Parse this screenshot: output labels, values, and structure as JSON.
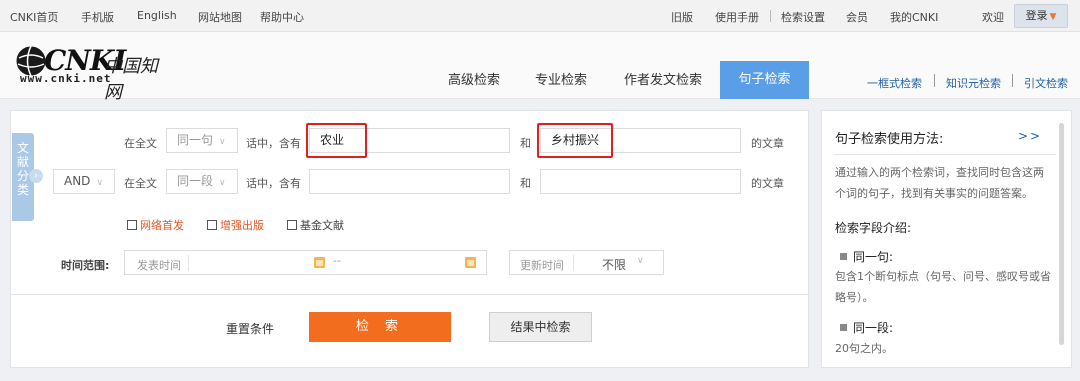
{
  "topnav": {
    "left_links": [
      "CNKI首页",
      "手机版",
      "English",
      "网站地图",
      "帮助中心"
    ],
    "right_links": [
      "旧版",
      "使用手册",
      "检索设置",
      "会员",
      "我的CNKI",
      "欢迎"
    ],
    "login_label": "登录"
  },
  "logo": {
    "main": "CNKI",
    "cn": "中国知网",
    "url": "www.cnki.net"
  },
  "tabs": [
    "高级检索",
    "专业检索",
    "作者发文检索",
    "句子检索"
  ],
  "active_tab": "句子检索",
  "header_links": [
    "一框式检索",
    "知识元检索",
    "引文检索"
  ],
  "side_tab": {
    "label": "文献分类"
  },
  "row1": {
    "scope_label": "在全文",
    "unit_select": "同一句",
    "contains_label": "话中，含有",
    "term1": "农业",
    "and_label": "和",
    "term2": "乡村振兴",
    "suffix": "的文章"
  },
  "row2": {
    "logic_select": "AND",
    "scope_label": "在全文",
    "unit_select": "同一段",
    "contains_label": "话中，含有",
    "term1": "",
    "and_label": "和",
    "term2": "",
    "suffix": "的文章"
  },
  "checkboxes": [
    {
      "label": "网络首发",
      "checked": false
    },
    {
      "label": "增强出版",
      "checked": false
    },
    {
      "label": "基金文献",
      "checked": false
    }
  ],
  "time": {
    "label": "时间范围:",
    "publish_placeholder": "发表时间",
    "range_sep": "--",
    "update_label": "更新时间",
    "update_value": "不限"
  },
  "actions": {
    "reset": "重置条件",
    "search": "检 索",
    "search_in_results": "结果中检索"
  },
  "help": {
    "title": "句子检索使用方法:",
    "more": ">>",
    "intro": "通过输入的两个检索词，查找同时包含这两个词的句子，找到有关事实的问题答案。",
    "fields_title": "检索字段介绍:",
    "field1_name": "同一句:",
    "field1_desc": "包含1个断句标点（句号、问号、感叹号或省略号）。",
    "field2_name": "同一段:",
    "field2_desc": "20句之内。"
  },
  "colors": {
    "accent_blue": "#5b9ee8",
    "search_orange": "#f36d1f",
    "highlight_red": "#e21f1f",
    "link_blue": "#1f5fa8"
  }
}
